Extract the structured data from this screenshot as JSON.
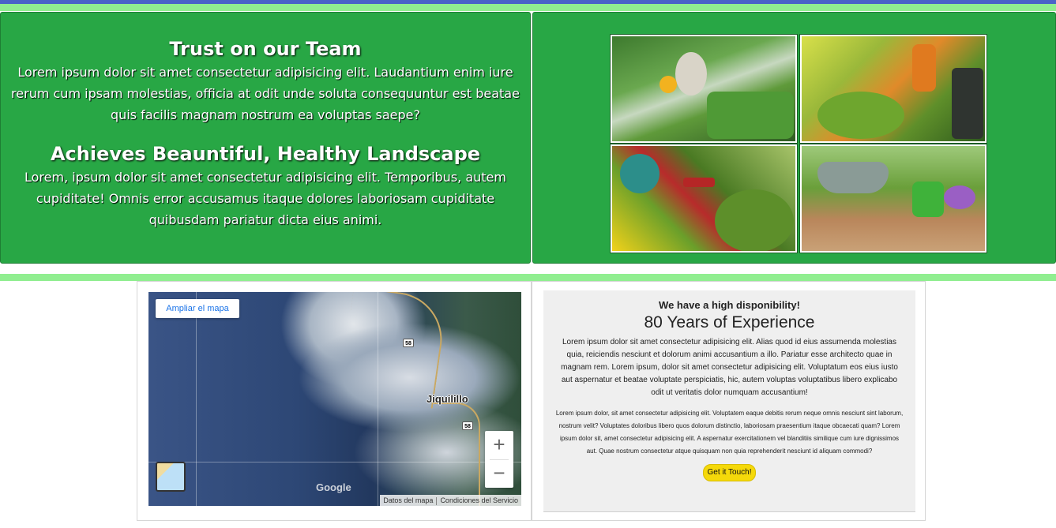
{
  "about": {
    "heading1": "Trust on our Team",
    "text1": "Lorem ipsum dolor sit amet consectetur adipisicing elit. Laudantium enim iure rerum cum ipsam molestias, officia at odit unde soluta consequuntur est beatae quis facilis magnam nostrum ea voluptas saepe?",
    "heading2": "Achieves Beauntiful, Healthy Landscape",
    "text2": "Lorem, ipsum dolor sit amet consectetur adipisicing elit. Temporibus, autem cupiditate! Omnis error accusamus itaque dolores laboriosam cupiditate quibusdam pariatur dicta eius animi."
  },
  "gallery": {
    "images": [
      "garden-statue-lawn",
      "gardener-trimming-hedge",
      "pruning-shears-boxwood",
      "wheelbarrow-watering-can-flowers"
    ]
  },
  "map": {
    "enlarge_label": "Ampliar el mapa",
    "place_label": "Jiquilillo",
    "road_shield_1": "58",
    "road_shield_2": "58",
    "zoom_in": "+",
    "zoom_out": "−",
    "logo_text": "Google",
    "attribution_data": "Datos del mapa",
    "attribution_terms": "Condiciones del Servicio"
  },
  "info": {
    "subtitle": "We have a high disponibility!",
    "title": "80 Years of Experience",
    "paragraph1": "Lorem ipsum dolor sit amet consectetur adipisicing elit. Alias quod id eius assumenda molestias quia, reiciendis nesciunt et dolorum animi accusantium a illo. Pariatur esse architecto quae in magnam rem. Lorem ipsum, dolor sit amet consectetur adipisicing elit. Voluptatum eos eius iusto aut aspernatur et beatae voluptate perspiciatis, hic, autem voluptas voluptatibus libero explicabo odit ut veritatis dolor numquam accusantium!",
    "paragraph2": "Lorem ipsum dolor, sit amet consectetur adipisicing elit. Voluptatem eaque debitis rerum neque omnis nesciunt sint laborum, nostrum velit? Voluptates doloribus libero quos dolorum distinctio, laboriosam praesentium itaque obcaecati quam? Lorem ipsum dolor sit, amet consectetur adipisicing elit. A aspernatur exercitationem vel blanditiis similique cum iure dignissimos aut. Quae nostrum consectetur atque quisquam non quia reprehenderit nesciunt id aliquam commodi?",
    "cta_label": "Get it Touch!"
  },
  "colors": {
    "panel_green": "#28a745",
    "accent_light_green": "#90ee90",
    "top_blue": "#4a63c8",
    "cta_yellow": "#f5d90a"
  }
}
